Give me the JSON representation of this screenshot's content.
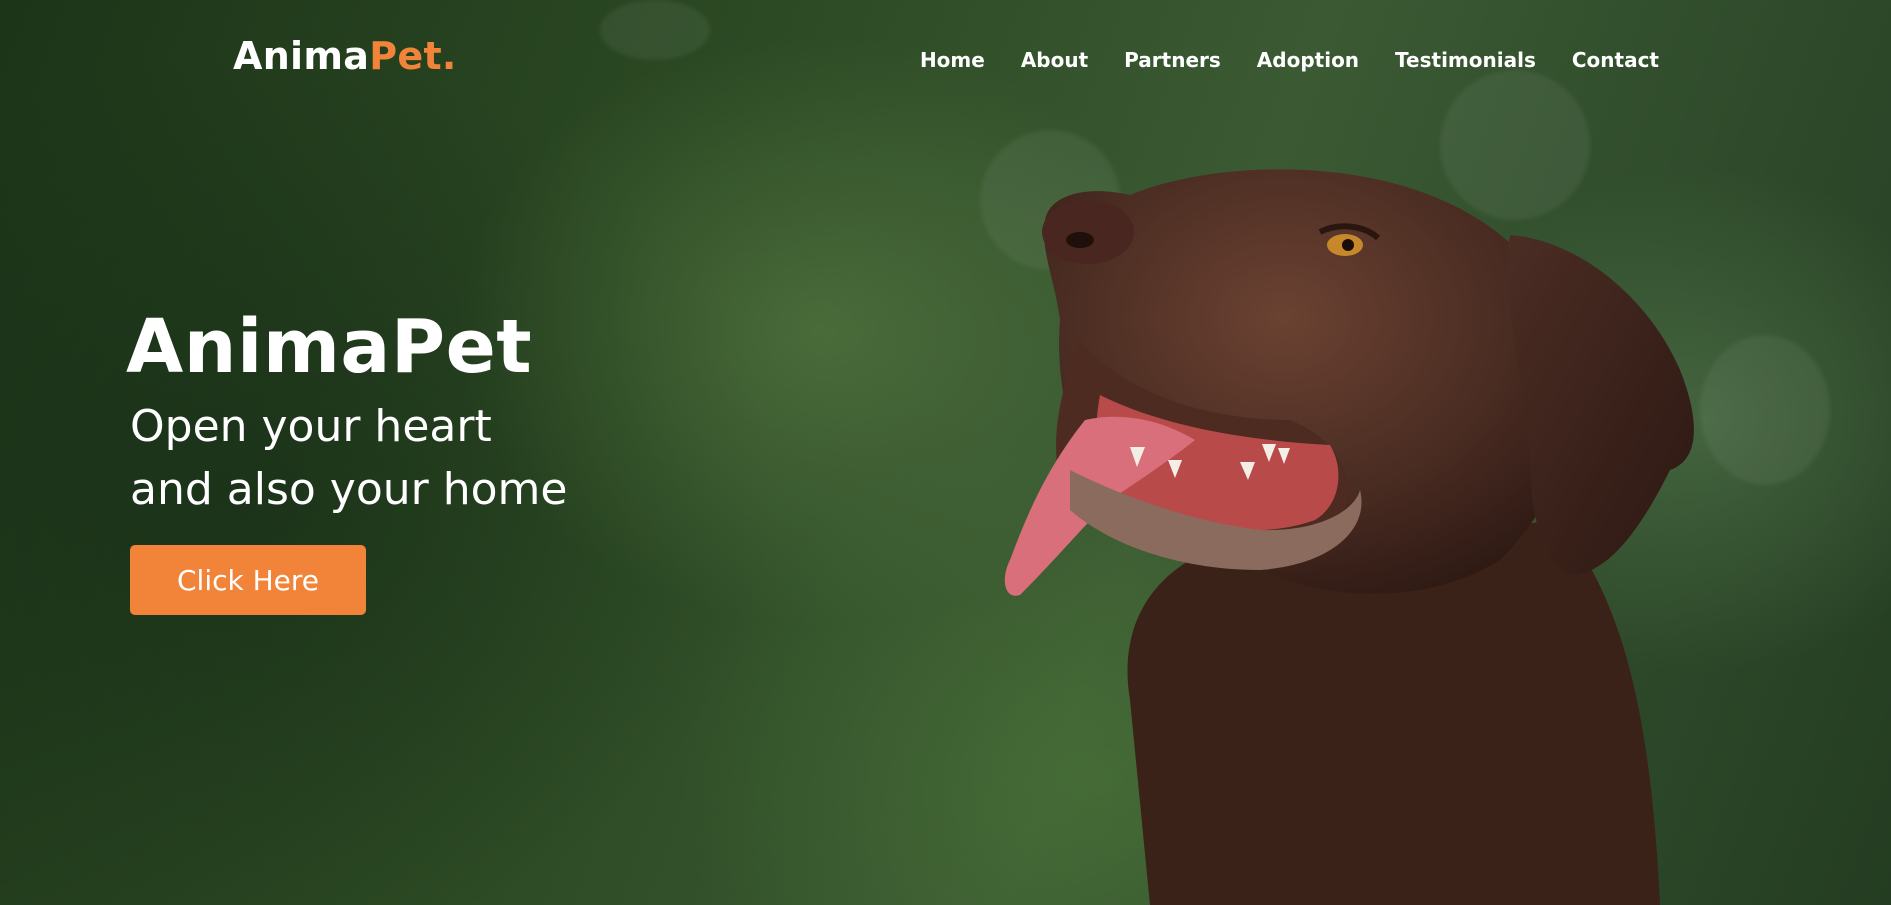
{
  "brand": {
    "logo_main": "Anima",
    "logo_accent": "Pet.",
    "accent_color": "#f2843a"
  },
  "nav": {
    "items": [
      {
        "label": "Home"
      },
      {
        "label": "About"
      },
      {
        "label": "Partners"
      },
      {
        "label": "Adoption"
      },
      {
        "label": "Testimonials"
      },
      {
        "label": "Contact"
      }
    ]
  },
  "hero": {
    "title": "AnimaPet",
    "tagline": "Open your heart\nand also your home",
    "button_label": "Click Here",
    "background_image": "chocolate-labrador-dog-photo"
  }
}
